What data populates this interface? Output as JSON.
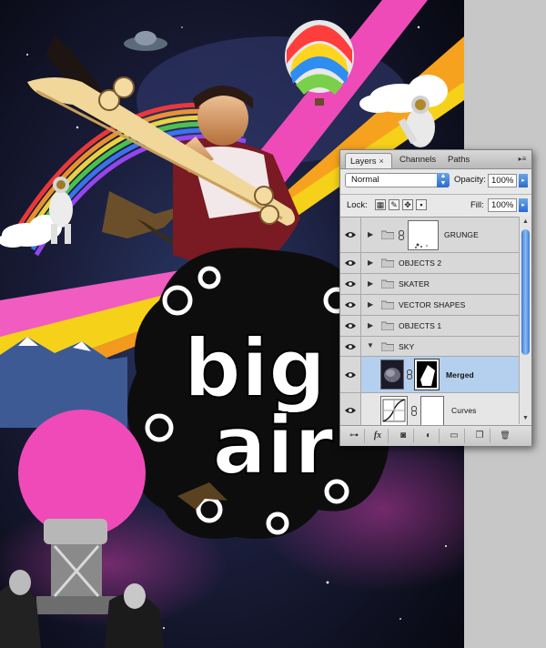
{
  "artwork": {
    "title_word_1": "big",
    "title_word_2": "air"
  },
  "layers_panel": {
    "tabs": [
      {
        "label": "Layers",
        "close": "×",
        "active": true
      },
      {
        "label": "Channels",
        "active": false
      },
      {
        "label": "Paths",
        "active": false
      }
    ],
    "blend_mode": "Normal",
    "opacity_label": "Opacity:",
    "opacity_value": "100%",
    "lock_label": "Lock:",
    "fill_label": "Fill:",
    "fill_value": "100%",
    "layers": [
      {
        "name": "GRUNGE",
        "type": "group",
        "expanded": false,
        "has_mask": true
      },
      {
        "name": "OBJECTS 2",
        "type": "group",
        "expanded": false
      },
      {
        "name": "SKATER",
        "type": "group",
        "expanded": false
      },
      {
        "name": "VECTOR SHAPES",
        "type": "group",
        "expanded": false
      },
      {
        "name": "OBJECTS 1",
        "type": "group",
        "expanded": false
      },
      {
        "name": "SKY",
        "type": "group",
        "expanded": true
      },
      {
        "name": "Merged",
        "type": "layer",
        "selected": true,
        "has_mask": true
      },
      {
        "name": "Curves",
        "type": "adjustment",
        "has_mask": true
      }
    ],
    "bottom_buttons": [
      "link-layers",
      "fx",
      "add-mask",
      "adjustment",
      "new-group",
      "new-layer",
      "delete"
    ],
    "bottom_labels": {
      "link": "⊶",
      "fx": "fx",
      "mask": "◙",
      "adj": "◐",
      "group": "▭",
      "new": "❐",
      "delete": "🗑"
    }
  },
  "colors": {
    "selected_row": "#b5d0ef",
    "accent_blue": "#2b6ad0",
    "poster_pink": "#f04ab8",
    "poster_yellow": "#f5d11a",
    "poster_orange": "#f39a1e"
  }
}
